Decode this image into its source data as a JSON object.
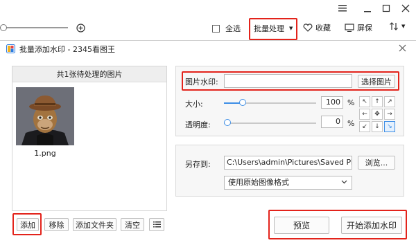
{
  "topbar": {
    "select_all_label": "全选",
    "batch_label": "批量处理",
    "favorite_label": "收藏",
    "screensaver_label": "屏保"
  },
  "dialog": {
    "title": "批量添加水印 - 2345看图王",
    "left_panel": {
      "header": "共1张待处理的图片",
      "thumbnails": [
        {
          "filename": "1.png"
        }
      ],
      "buttons": {
        "add": "添加",
        "remove": "移除",
        "add_folder": "添加文件夹",
        "clear": "清空"
      }
    },
    "watermark": {
      "image_label": "图片水印:",
      "image_value": "",
      "choose_button": "选择图片",
      "size_label": "大小:",
      "size_value": "100",
      "size_unit": "%",
      "size_slider": 0.2,
      "opacity_label": "透明度:",
      "opacity_value": "0",
      "opacity_unit": "%",
      "opacity_slider": 0.0
    },
    "save": {
      "label": "另存到:",
      "path": "C:\\Users\\admin\\Pictures\\Saved Pictu",
      "browse_button": "浏览...",
      "format_value": "使用原始图像格式"
    },
    "actions": {
      "preview": "预览",
      "start": "开始添加水印"
    }
  },
  "colors": {
    "highlight": "#e3231b",
    "accent": "#3d8ee6"
  }
}
